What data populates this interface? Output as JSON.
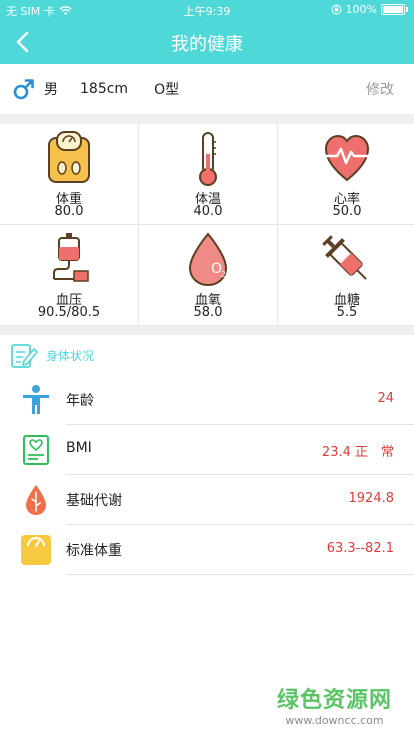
{
  "status_bar": {
    "carrier": "无 SIM 卡",
    "time": "上午9:39",
    "battery": "100%"
  },
  "nav": {
    "title": "我的健康"
  },
  "profile": {
    "gender": "男",
    "height": "185cm",
    "blood_type": "O型",
    "edit_label": "修改"
  },
  "metrics": [
    {
      "label": "体重",
      "value": "80.0",
      "icon": "scale-icon"
    },
    {
      "label": "体温",
      "value": "40.0",
      "icon": "thermometer-icon"
    },
    {
      "label": "心率",
      "value": "50.0",
      "icon": "heart-rate-icon"
    },
    {
      "label": "血压",
      "value": "90.5/80.5",
      "icon": "blood-bag-icon"
    },
    {
      "label": "血氧",
      "value": "58.0",
      "icon": "oxygen-drop-icon"
    },
    {
      "label": "血糖",
      "value": "5.5",
      "icon": "syringe-icon"
    }
  ],
  "section": {
    "title": "身体状况"
  },
  "conditions": [
    {
      "name": "年龄",
      "value": "24",
      "icon": "person-icon"
    },
    {
      "name": "BMI",
      "value": "23.4 正　常",
      "icon": "bmi-report-icon"
    },
    {
      "name": "基础代谢",
      "value": "1924.8",
      "icon": "metabolism-drop-icon"
    },
    {
      "name": "标准体重",
      "value": "63.3--82.1",
      "icon": "scale-icon"
    }
  ],
  "watermark": {
    "main": "绿色资源网",
    "sub": "www.downcc.com"
  },
  "colors": {
    "accent": "#4fd8d8",
    "value_red": "#e23b3b",
    "divider": "#efefef"
  }
}
